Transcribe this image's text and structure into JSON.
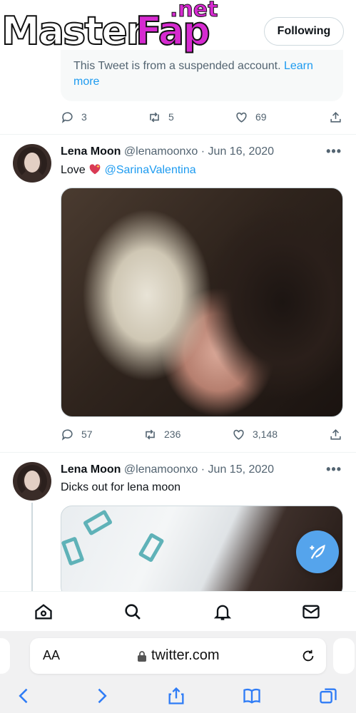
{
  "watermark": {
    "part1": "Master",
    "part2": "Fap",
    "part3": ".net"
  },
  "header": {
    "following_label": "Following"
  },
  "suspended_tweet": {
    "notice": "This Tweet is from a suspended account.",
    "learn_more": "Learn more",
    "replies": "3",
    "retweets": "5",
    "likes": "69"
  },
  "tweets": [
    {
      "name": "Lena Moon",
      "handle": "@lenamoonxo",
      "date": "Jun 16, 2020",
      "text": "Love",
      "emoji": "heart-with-sparkle",
      "mention": "@SarinaValentina",
      "replies": "57",
      "retweets": "236",
      "likes": "3,148"
    },
    {
      "name": "Lena Moon",
      "handle": "@lenamoonxo",
      "date": "Jun 15, 2020",
      "text": "Dicks out for lena moon"
    }
  ],
  "more_glyph": "•••",
  "separator": "·",
  "browser": {
    "aa_label": "AA",
    "url": "twitter.com"
  },
  "colors": {
    "accent": "#1d9bf0",
    "fab": "#55a4ec",
    "muted": "#536471"
  }
}
